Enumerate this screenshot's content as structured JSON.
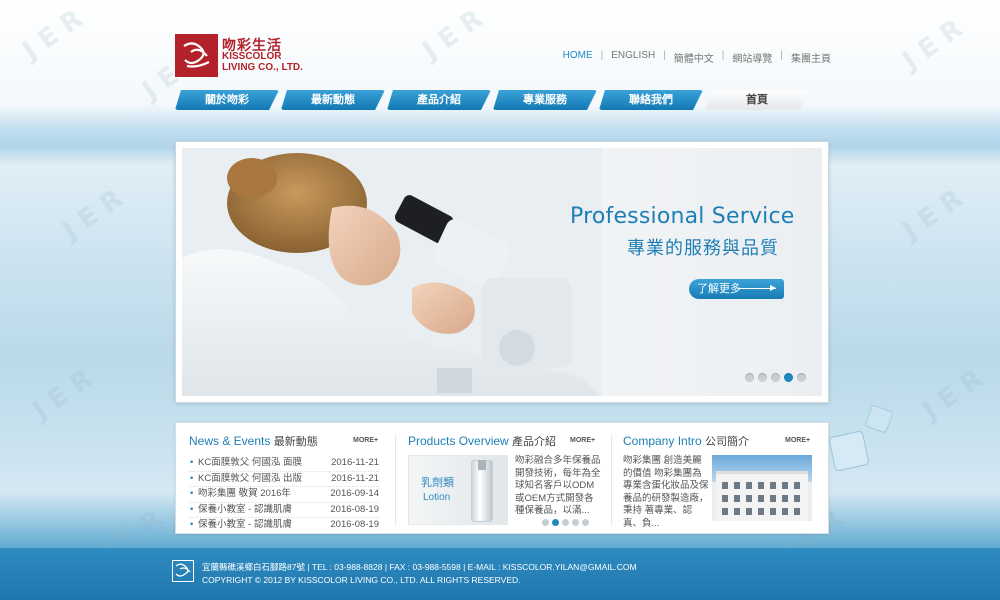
{
  "brand": {
    "name_cn": "吻彩生活",
    "name_en_line1": "KISSCOLOR",
    "name_en_line2": "LIVING CO., LTD.",
    "color": "#b3222a"
  },
  "top_links": [
    {
      "label": "HOME",
      "active": true
    },
    {
      "label": "ENGLISH",
      "active": false
    },
    {
      "label": "簡體中文",
      "active": false
    },
    {
      "label": "網站導覽",
      "active": false
    },
    {
      "label": "集團主頁",
      "active": false
    }
  ],
  "nav": [
    {
      "label": "關於吻彩"
    },
    {
      "label": "最新動態"
    },
    {
      "label": "產品介紹"
    },
    {
      "label": "專業服務"
    },
    {
      "label": "聯絡我們"
    },
    {
      "label": "首頁"
    }
  ],
  "banner": {
    "title": "Professional Service",
    "subtitle": "專業的服務與品質",
    "button": "了解更多",
    "slide_count": 5,
    "active_slide": 4
  },
  "news": {
    "title_en": "News & Events",
    "title_cn": "最新動態",
    "more": "MORE+",
    "items": [
      {
        "title": "KC面膜敦父 何國泓 面膜",
        "date": "2016-11-21"
      },
      {
        "title": "KC面膜敦父 何國泓 出版",
        "date": "2016-11-21"
      },
      {
        "title": "吻彩集團 敬賀 2016年",
        "date": "2016-09-14"
      },
      {
        "title": "保養小教室 - 認識肌膚",
        "date": "2016-08-19"
      },
      {
        "title": "保養小教室 - 認識肌膚",
        "date": "2016-08-19"
      }
    ]
  },
  "products": {
    "title_en": "Products Overview",
    "title_cn": "產品介紹",
    "more": "MORE+",
    "image_label_cn": "乳劑類",
    "image_label_en": "Lotion",
    "description": "吻彩融合多年保養品開發技術，每年為全球知名客戶以ODM或OEM方式開發各種保養品，以滿...",
    "dot_count": 5,
    "active_dot": 2
  },
  "company": {
    "title_en": "Company Intro",
    "title_cn": "公司簡介",
    "more": "MORE+",
    "description": "吻彩集團 創造美麗的價值 吻彩集團為專業含蛋化妝品及保養品的研發製造廠，秉持 著專業、認真、負..."
  },
  "footer": {
    "line1": "宜蘭縣礁溪鄉白石腳路87號 | TEL : 03-988-8828 | FAX : 03-988-5598 | E-MAIL : KISSCOLOR.YILAN@GMAIL.COM",
    "line2": "COPYRIGHT © 2012 BY KISSCOLOR LIVING CO., LTD. ALL RIGHTS RESERVED."
  },
  "colors": {
    "accent": "#1e7fb7",
    "nav_blue": "#1278b3",
    "footer": "#2482b8"
  },
  "icons": {
    "logo": "kisscolor-logo-icon",
    "more_arrow": "arrow-right-icon"
  }
}
